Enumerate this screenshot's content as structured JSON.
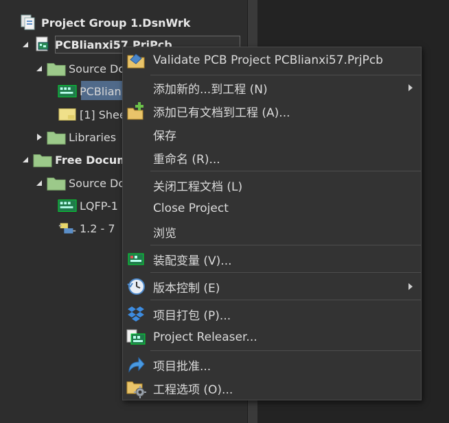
{
  "tree": {
    "group": "Project Group 1.DsnWrk",
    "project": "PCBlianxi57.PrjPcb",
    "source_documents": "Source Do",
    "pcb_file": "PCBlian",
    "sheet": "[1] Shee",
    "libraries": "Libraries",
    "free_documents": "Free Docum",
    "free_source": "Source Do",
    "lqfp": "LQFP-1",
    "version_item": "1.2    - 7"
  },
  "menu": {
    "items": [
      {
        "label": "Validate PCB Project PCBlianxi57.PrjPcb",
        "icon": "validate-icon"
      },
      {
        "label": "添加新的...到工程 (N)",
        "icon": "",
        "submenu": true
      },
      {
        "label": "添加已有文档到工程 (A)...",
        "icon": "add-existing-icon"
      },
      {
        "label": "保存",
        "icon": ""
      },
      {
        "label": "重命名 (R)...",
        "icon": ""
      },
      {
        "label": "关闭工程文档 (L)",
        "icon": ""
      },
      {
        "label": "Close Project",
        "icon": ""
      },
      {
        "label": "浏览",
        "icon": ""
      },
      {
        "label": "装配变量 (V)...",
        "icon": "variant-icon"
      },
      {
        "label": "版本控制 (E)",
        "icon": "clock-icon",
        "submenu": true
      },
      {
        "label": "项目打包 (P)...",
        "icon": "dropbox-icon"
      },
      {
        "label": "Project Releaser...",
        "icon": "releaser-icon"
      },
      {
        "label": "项目批准...",
        "icon": "share-arrow-icon"
      },
      {
        "label": "工程选项 (O)...",
        "icon": "folder-gear-icon"
      }
    ]
  },
  "colors": {
    "folder": "#9cc98a",
    "pcb_green": "#1f7a4a",
    "accent_blue": "#4a86c8",
    "selection": "#506a8a"
  }
}
